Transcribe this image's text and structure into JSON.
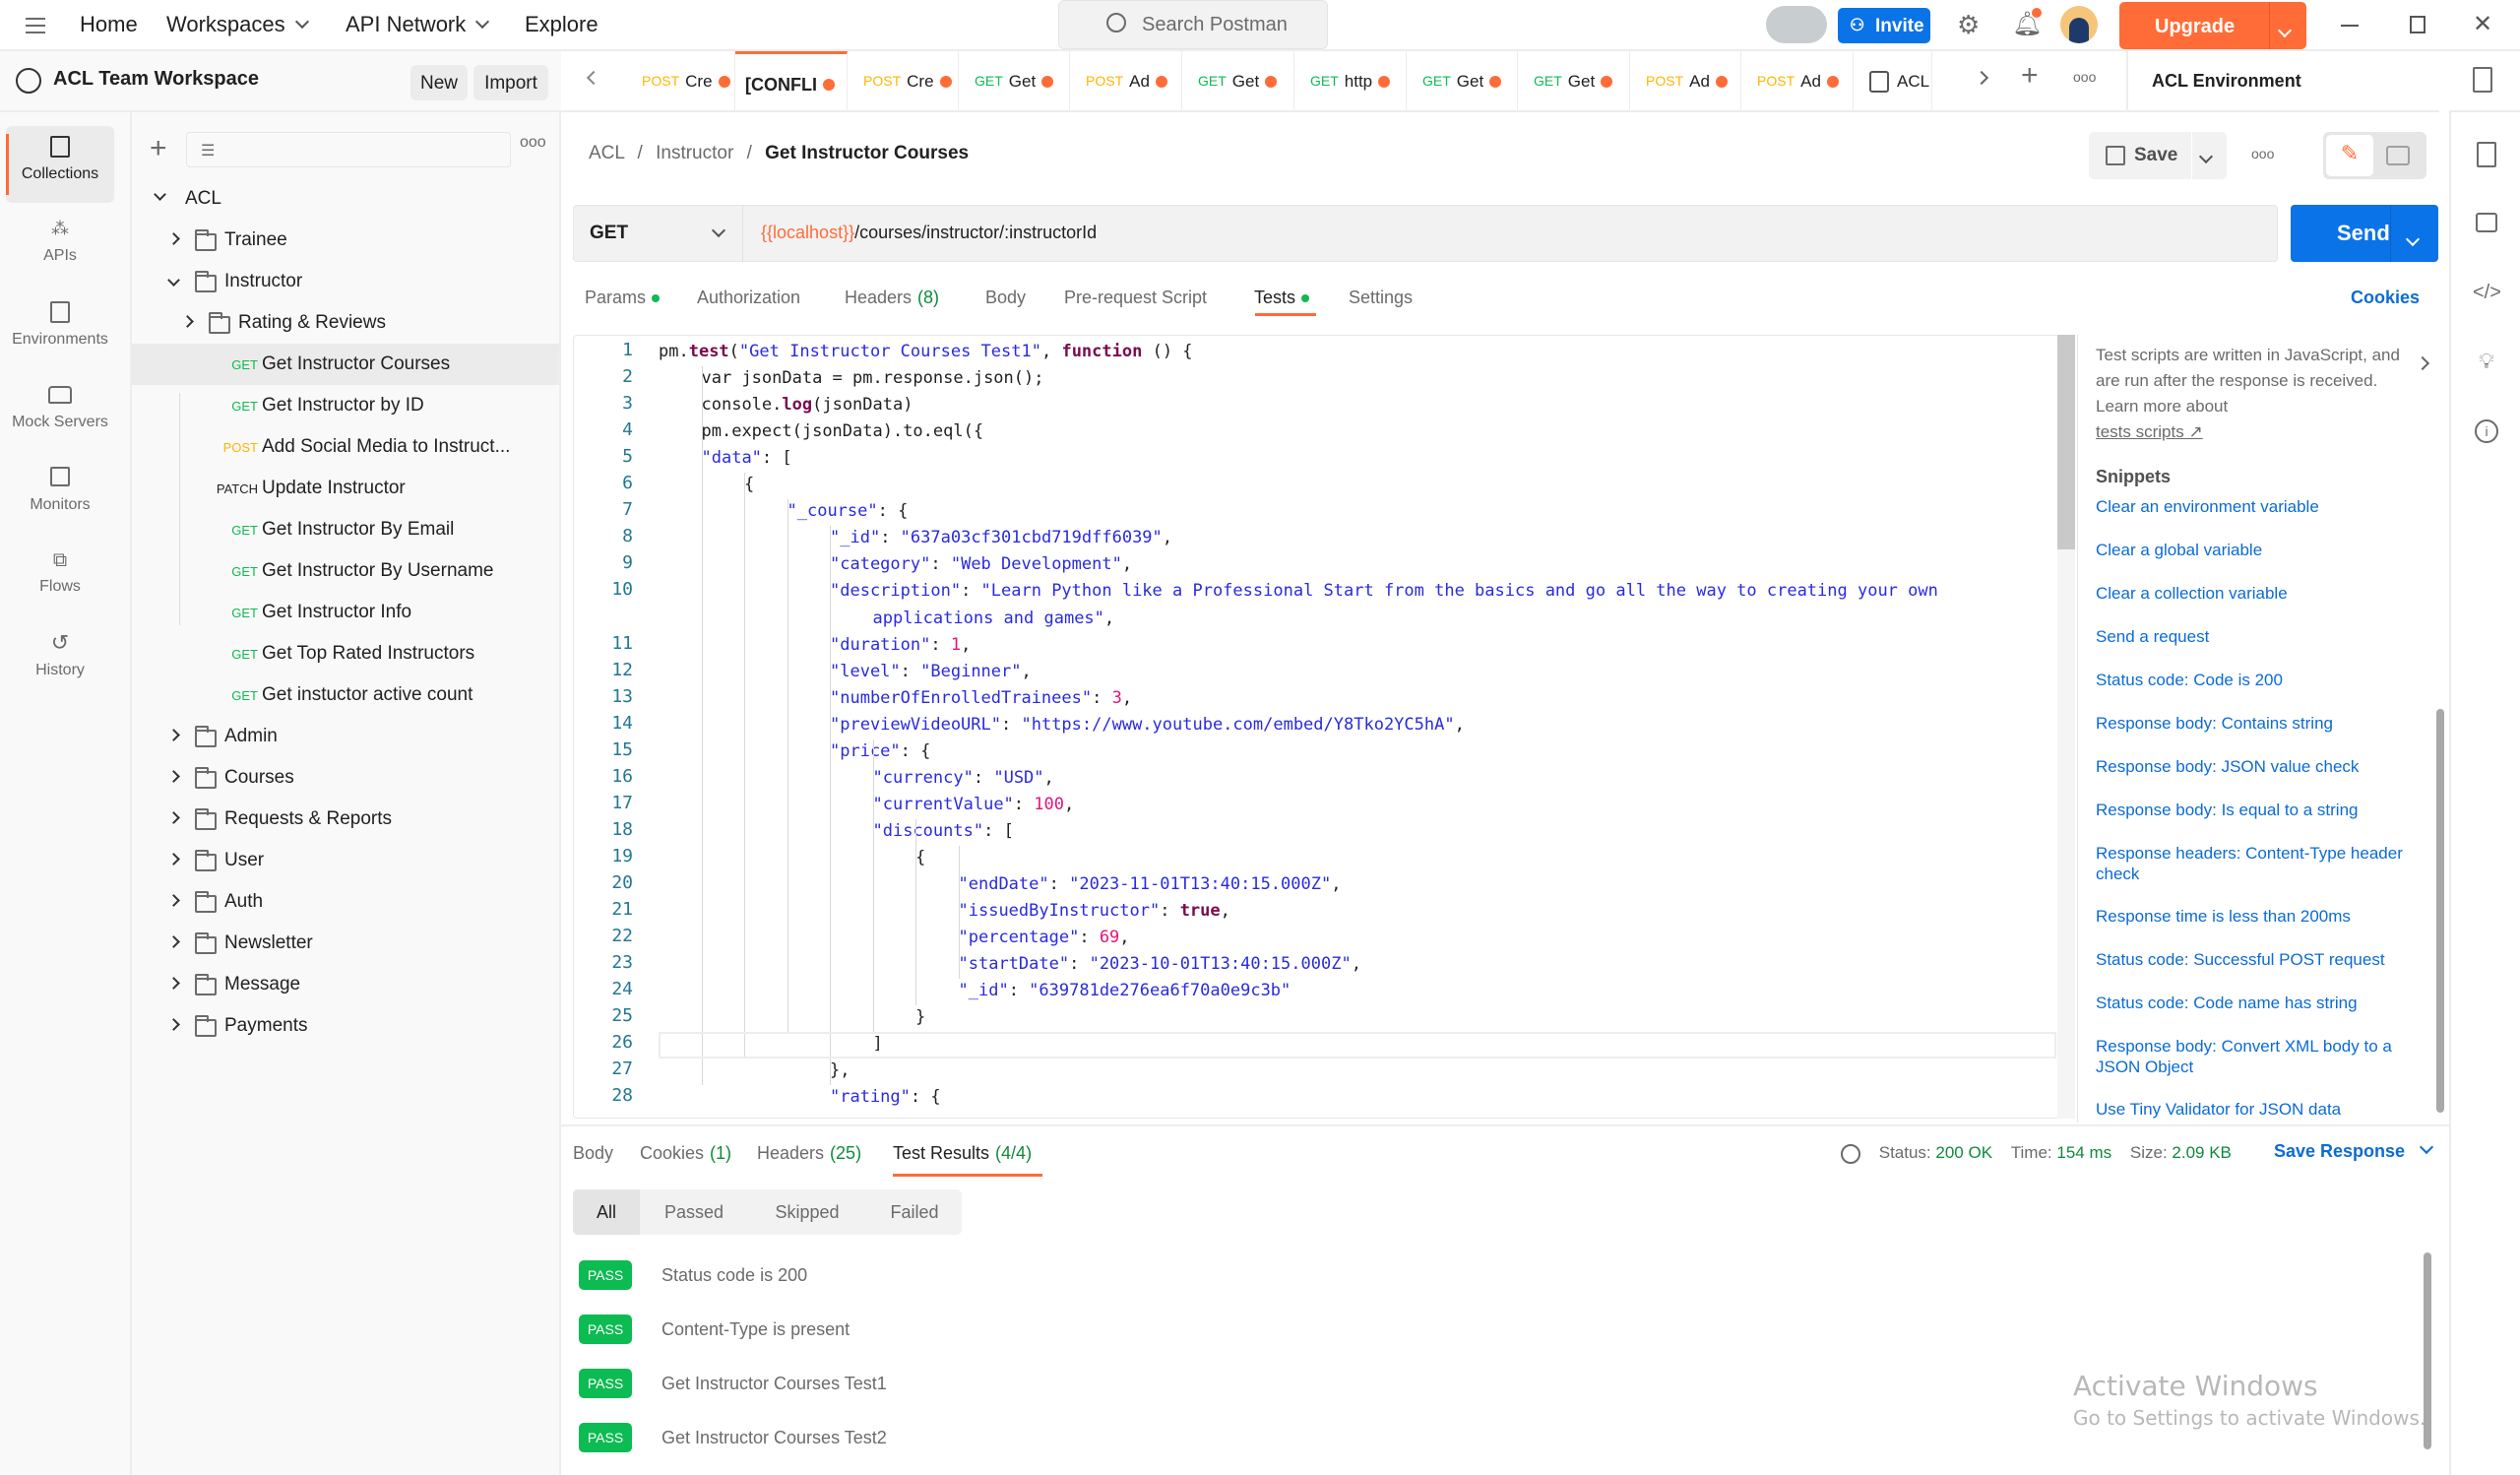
{
  "topbar": {
    "nav": [
      "Home",
      "Workspaces",
      "API Network",
      "Explore"
    ],
    "search_placeholder": "Search Postman",
    "invite_label": "Invite",
    "upgrade_label": "Upgrade"
  },
  "workspace": {
    "name": "ACL Team Workspace",
    "new_label": "New",
    "import_label": "Import"
  },
  "rail": [
    {
      "label": "Collections",
      "icon": "collections-icon"
    },
    {
      "label": "APIs",
      "icon": "apis-icon"
    },
    {
      "label": "Environments",
      "icon": "environments-icon"
    },
    {
      "label": "Mock Servers",
      "icon": "mock-servers-icon"
    },
    {
      "label": "Monitors",
      "icon": "monitors-icon"
    },
    {
      "label": "Flows",
      "icon": "flows-icon"
    },
    {
      "label": "History",
      "icon": "history-icon"
    }
  ],
  "tree": {
    "root": "ACL",
    "items": [
      {
        "type": "folder",
        "label": "Trainee",
        "expanded": false
      },
      {
        "type": "folder",
        "label": "Instructor",
        "expanded": true
      },
      {
        "type": "folder",
        "label": "Rating & Reviews",
        "expanded": false
      },
      {
        "type": "request",
        "method": "GET",
        "label": "Get Instructor Courses",
        "selected": true
      },
      {
        "type": "request",
        "method": "GET",
        "label": "Get Instructor by ID"
      },
      {
        "type": "request",
        "method": "POST",
        "label": "Add Social Media to Instruct..."
      },
      {
        "type": "request",
        "method": "PATCH",
        "label": "Update Instructor"
      },
      {
        "type": "request",
        "method": "GET",
        "label": "Get Instructor By Email"
      },
      {
        "type": "request",
        "method": "GET",
        "label": "Get Instructor By Username"
      },
      {
        "type": "request",
        "method": "GET",
        "label": "Get Instructor Info"
      },
      {
        "type": "request",
        "method": "GET",
        "label": "Get Top Rated Instructors"
      },
      {
        "type": "request",
        "method": "GET",
        "label": "Get instuctor active count"
      },
      {
        "type": "folder",
        "label": "Admin"
      },
      {
        "type": "folder",
        "label": "Courses"
      },
      {
        "type": "folder",
        "label": "Requests & Reports"
      },
      {
        "type": "folder",
        "label": "User"
      },
      {
        "type": "folder",
        "label": "Auth"
      },
      {
        "type": "folder",
        "label": "Newsletter"
      },
      {
        "type": "folder",
        "label": "Message"
      },
      {
        "type": "folder",
        "label": "Payments"
      }
    ]
  },
  "tabs": [
    {
      "method": "POST",
      "label": "Cre"
    },
    {
      "method": "",
      "label": "[CONFLI",
      "active": true
    },
    {
      "method": "POST",
      "label": "Cre"
    },
    {
      "method": "GET",
      "label": "Get"
    },
    {
      "method": "POST",
      "label": "Ad"
    },
    {
      "method": "GET",
      "label": "Get"
    },
    {
      "method": "GET",
      "label": "http"
    },
    {
      "method": "GET",
      "label": "Get"
    },
    {
      "method": "GET",
      "label": "Get"
    },
    {
      "method": "POST",
      "label": "Ad"
    },
    {
      "method": "POST",
      "label": "Ad"
    },
    {
      "method": "ENV",
      "label": "ACL"
    }
  ],
  "environment": "ACL Environment",
  "request": {
    "breadcrumb": [
      "ACL",
      "Instructor",
      "Get Instructor Courses"
    ],
    "save_label": "Save",
    "method": "GET",
    "url_var": "{{localhost}}",
    "url_path": "/courses/instructor/:instructorId",
    "send_label": "Send",
    "tabs": [
      {
        "label": "Params",
        "dot": true
      },
      {
        "label": "Authorization"
      },
      {
        "label": "Headers",
        "count": "(8)"
      },
      {
        "label": "Body"
      },
      {
        "label": "Pre-request Script"
      },
      {
        "label": "Tests",
        "dot": true,
        "active": true
      },
      {
        "label": "Settings"
      }
    ],
    "cookies_label": "Cookies"
  },
  "editor": {
    "lines": [
      {
        "n": "1",
        "html": "pm.<b class='k'>test</b>(<span class='s'>\"Get Instructor Courses Test1\"</span>, <b class='k'>function</b> () {",
        "indent": 0
      },
      {
        "n": "2",
        "html": "var jsonData = pm.response.json();",
        "indent": 1
      },
      {
        "n": "3",
        "html": "console.<b class='k'>log</b>(jsonData)",
        "indent": 1
      },
      {
        "n": "4",
        "html": "pm.expect(jsonData).to.eql({",
        "indent": 1
      },
      {
        "n": "5",
        "html": "<span class='key'>\"data\"</span>: [",
        "indent": 1
      },
      {
        "n": "6",
        "html": "{",
        "indent": 2
      },
      {
        "n": "7",
        "html": "<span class='key'>\"_course\"</span>: {",
        "indent": 3
      },
      {
        "n": "8",
        "html": "<span class='key'>\"_id\"</span>: <span class='s'>\"637a03cf301cbd719dff6039\"</span>,",
        "indent": 4
      },
      {
        "n": "9",
        "html": "<span class='key'>\"category\"</span>: <span class='s'>\"Web Development\"</span>,",
        "indent": 4
      },
      {
        "n": "10",
        "html": "<span class='key'>\"description\"</span>: <span class='s'>\"Learn Python like a Professional Start from the basics and go all the way to creating your own</span>",
        "indent": 4
      },
      {
        "n": "",
        "html": "<span class='s'>applications and games\"</span>,",
        "indent": 5
      },
      {
        "n": "11",
        "html": "<span class='key'>\"duration\"</span>: <span class='n'>1</span>,",
        "indent": 4
      },
      {
        "n": "12",
        "html": "<span class='key'>\"level\"</span>: <span class='s'>\"Beginner\"</span>,",
        "indent": 4
      },
      {
        "n": "13",
        "html": "<span class='key'>\"numberOfEnrolledTrainees\"</span>: <span class='n'>3</span>,",
        "indent": 4
      },
      {
        "n": "14",
        "html": "<span class='key'>\"previewVideoURL\"</span>: <span class='s'>\"https://www.youtube.com/embed/Y8Tko2YC5hA\"</span>,",
        "indent": 4
      },
      {
        "n": "15",
        "html": "<span class='key'>\"price\"</span>: {",
        "indent": 4
      },
      {
        "n": "16",
        "html": "<span class='key'>\"currency\"</span>: <span class='s'>\"USD\"</span>,",
        "indent": 5
      },
      {
        "n": "17",
        "html": "<span class='key'>\"currentValue\"</span>: <span class='n'>100</span>,",
        "indent": 5
      },
      {
        "n": "18",
        "html": "<span class='key'>\"discounts\"</span>: [",
        "indent": 5
      },
      {
        "n": "19",
        "html": "{",
        "indent": 6
      },
      {
        "n": "20",
        "html": "<span class='key'>\"endDate\"</span>: <span class='s'>\"2023-11-01T13:40:15.000Z\"</span>,",
        "indent": 7
      },
      {
        "n": "21",
        "html": "<span class='key'>\"issuedByInstructor\"</span>: <b class='k'>true</b>,",
        "indent": 7
      },
      {
        "n": "22",
        "html": "<span class='key'>\"percentage\"</span>: <span class='n'>69</span>,",
        "indent": 7
      },
      {
        "n": "23",
        "html": "<span class='key'>\"startDate\"</span>: <span class='s'>\"2023-10-01T13:40:15.000Z\"</span>,",
        "indent": 7
      },
      {
        "n": "24",
        "html": "<span class='key'>\"_id\"</span>: <span class='s'>\"639781de276ea6f70a0e9c3b\"</span>",
        "indent": 7
      },
      {
        "n": "25",
        "html": "}",
        "indent": 6
      },
      {
        "n": "26",
        "html": "]",
        "indent": 5
      },
      {
        "n": "27",
        "html": "},",
        "indent": 4
      },
      {
        "n": "28",
        "html": "<span class='key'>\"rating\"</span>: {",
        "indent": 4
      }
    ]
  },
  "snippets": {
    "intro": "Test scripts are written in JavaScript, and are run after the response is received. Learn more about",
    "link": "tests scripts ↗",
    "heading": "Snippets",
    "items": [
      "Clear an environment variable",
      "Clear a global variable",
      "Clear a collection variable",
      "Send a request",
      "Status code: Code is 200",
      "Response body: Contains string",
      "Response body: JSON value check",
      "Response body: Is equal to a string",
      "Response headers: Content-Type header check",
      "Response time is less than 200ms",
      "Status code: Successful POST request",
      "Status code: Code name has string",
      "Response body: Convert XML body to a JSON Object",
      "Use Tiny Validator for JSON data"
    ]
  },
  "response": {
    "tabs": [
      {
        "label": "Body"
      },
      {
        "label": "Cookies",
        "count": "(1)"
      },
      {
        "label": "Headers",
        "count": "(25)"
      },
      {
        "label": "Test Results",
        "count": "(4/4)",
        "active": true
      }
    ],
    "status_label": "Status:",
    "status": "200 OK",
    "time_label": "Time:",
    "time": "154 ms",
    "size_label": "Size:",
    "size": "2.09 KB",
    "save_label": "Save Response",
    "filters": [
      "All",
      "Passed",
      "Skipped",
      "Failed"
    ],
    "results": [
      {
        "status": "PASS",
        "name": "Status code is 200"
      },
      {
        "status": "PASS",
        "name": "Content-Type is present"
      },
      {
        "status": "PASS",
        "name": "Get Instructor Courses Test1"
      },
      {
        "status": "PASS",
        "name": "Get Instructor Courses Test2"
      }
    ]
  },
  "watermark": {
    "title": "Activate Windows",
    "subtitle": "Go to Settings to activate Windows."
  },
  "colors": {
    "accent": "#ff6c37",
    "primary": "#0b73e8",
    "get": "#0cbb52",
    "post": "#ffb400"
  }
}
